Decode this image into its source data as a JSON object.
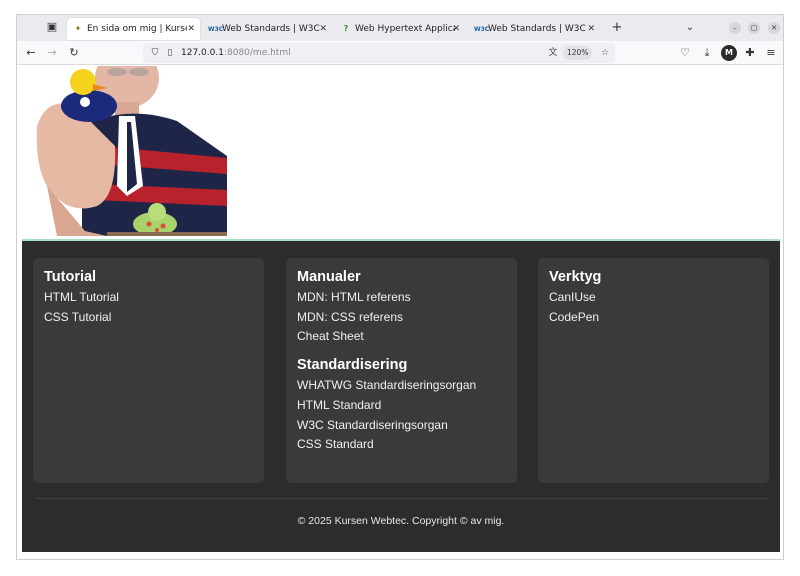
{
  "browser": {
    "tabs": [
      {
        "title": "En sida om mig | Kursen w",
        "active": true
      },
      {
        "title": "Web Standards | W3C",
        "active": false
      },
      {
        "title": "Web Hypertext Applicatio",
        "active": false
      },
      {
        "title": "Web Standards | W3C",
        "active": false
      }
    ],
    "url_host": "127.0.0.1",
    "url_rest": ":8080/me.html",
    "zoom": "120%",
    "account_initial": "M"
  },
  "sections": {
    "tutorial": {
      "heading": "Tutorial",
      "links": [
        "HTML Tutorial",
        "CSS Tutorial"
      ]
    },
    "manualer": {
      "heading": "Manualer",
      "links": [
        "MDN: HTML referens",
        "MDN: CSS referens",
        "Cheat Sheet"
      ]
    },
    "standardisering": {
      "heading": "Standardisering",
      "links": [
        "WHATWG Standardiseringsorgan",
        "HTML Standard",
        "W3C Standardiseringsorgan",
        "CSS Standard"
      ]
    },
    "verktyg": {
      "heading": "Verktyg",
      "links": [
        "CanIUse",
        "CodePen"
      ]
    }
  },
  "footer": {
    "text": "© 2025 Kursen Webtec. Copyright © av mig."
  },
  "colors": {
    "page_bg": "#2c2c2c",
    "card_bg": "#3a3a3a",
    "accent_line": "#a8e0c6",
    "text": "#f1f1f1"
  }
}
